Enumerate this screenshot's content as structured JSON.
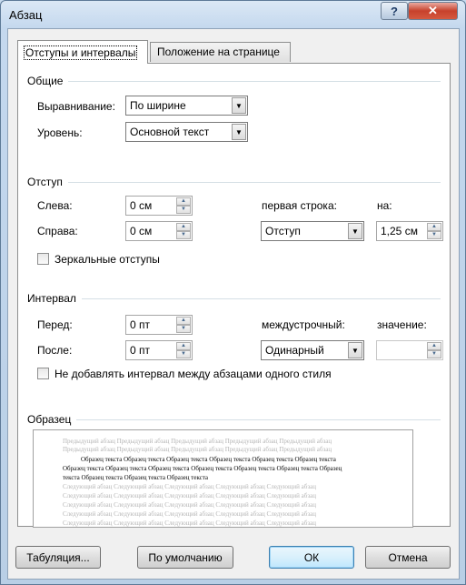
{
  "window": {
    "title": "Абзац",
    "help_icon": "?",
    "close_icon": "✕"
  },
  "tabs": [
    {
      "label": "Отступы и интервалы",
      "active": true
    },
    {
      "label": "Положение на странице",
      "active": false
    }
  ],
  "general": {
    "header": "Общие",
    "alignment_label": "Выравнивание:",
    "alignment_value": "По ширине",
    "level_label": "Уровень:",
    "level_value": "Основной текст"
  },
  "indent": {
    "header": "Отступ",
    "left_label": "Слева:",
    "left_value": "0 см",
    "right_label": "Справа:",
    "right_value": "0 см",
    "first_line_label": "первая строка:",
    "first_line_value": "Отступ",
    "by_label": "на:",
    "by_value": "1,25 см",
    "mirror_label": "Зеркальные отступы",
    "mirror_checked": false
  },
  "spacing": {
    "header": "Интервал",
    "before_label": "Перед:",
    "before_value": "0 пт",
    "after_label": "После:",
    "after_value": "0 пт",
    "line_label": "междустрочный:",
    "line_value": "Одинарный",
    "at_label": "значение:",
    "at_value": "",
    "no_space_label": "Не добавлять интервал между абзацами одного стиля",
    "no_space_checked": false
  },
  "preview": {
    "header": "Образец",
    "prev_lines": [
      "Предыдущий абзац Предыдущий абзац Предыдущий абзац Предыдущий абзац Предыдущий абзац",
      "Предыдущий абзац Предыдущий абзац Предыдущий абзац Предыдущий абзац Предыдущий абзац"
    ],
    "sample_lines": [
      "Образец текста Образец текста Образец текста Образец текста Образец текста Образец текста",
      "Образец текста Образец текста Образец текста Образец текста Образец текста Образец текста Образец",
      "текста Образец текста Образец текста Образец текста"
    ],
    "next_lines": [
      "Следующий абзац Следующий абзац Следующий абзац Следующий абзац Следующий абзац",
      "Следующий абзац Следующий абзац Следующий абзац Следующий абзац Следующий абзац",
      "Следующий абзац Следующий абзац Следующий абзац Следующий абзац Следующий абзац",
      "Следующий абзац Следующий абзац Следующий абзац Следующий абзац Следующий абзац",
      "Следующий абзац Следующий абзац Следующий абзац Следующий абзац Следующий абзац"
    ]
  },
  "buttons": {
    "tabs": "Табуляция...",
    "default": "По умолчанию",
    "ok": "ОК",
    "cancel": "Отмена"
  },
  "colors": {
    "window_frame": "#b9cfe6",
    "close_button": "#c7412c",
    "preview_text_grey": "#b5b5b5",
    "default_button_accent": "#3c7fb1"
  }
}
